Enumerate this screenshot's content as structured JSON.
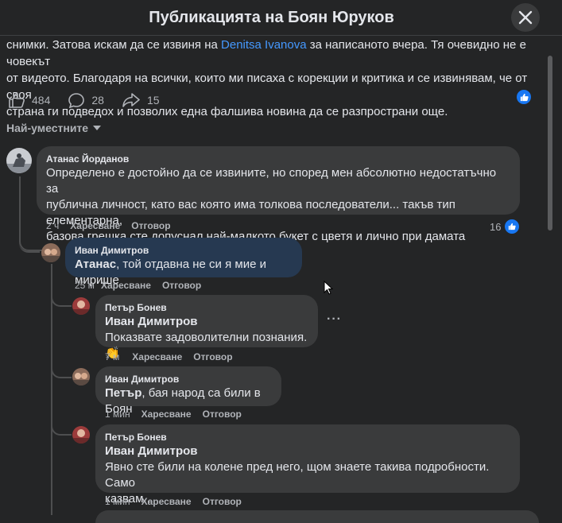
{
  "header": {
    "title": "Публикацията на Боян Юруков",
    "close_icon": "close-icon"
  },
  "post": {
    "line1_before": "снимки. Затова искам да се извиня на ",
    "line1_mention": "Denitsa Ivanova",
    "line1_after": " за написаното вчера. Тя очевидно не е човекът",
    "line2": "от видеото. Благодаря на всички, които ми писаха с корекции и критика и се извинявам, че от своя",
    "line3": "страна ги подведох и позволих една фалшива новина да се разпространи още."
  },
  "reactions": {
    "likes": "484",
    "comments": "28",
    "shares": "15"
  },
  "sort_label": "Най-уместните",
  "comments": [
    {
      "author": "Атанас Йорданов",
      "text_line1": "Определено е достойно да се извините, но според мен абсолютно недостатъчно за",
      "text_line2": "публична личност, като вас която има толкова последователи... такъв тип елементарна,",
      "text_line3": "базова грешка сте допуснал най-малкото букет с цветя и лично при дамата",
      "time": "2 ч",
      "like_label": "Харесване",
      "reply_label": "Отговор",
      "like_count": "16"
    },
    {
      "author": "Иван Димитров",
      "tag": "Атанас",
      "text": ", той отдавна не си я мие и мирише",
      "time": "25 м",
      "like_label": "Харесване",
      "reply_label": "Отговор"
    },
    {
      "author": "Петър Бонев",
      "tag": "Иван Димитров",
      "text": "Показвате задоволителни познания. 👏",
      "time": "7 м",
      "like_label": "Харесване",
      "reply_label": "Отговор"
    },
    {
      "author": "Иван Димитров",
      "tag": "Петър",
      "text": ", бая народ са били в Боян",
      "time": "1 мин",
      "like_label": "Харесване",
      "reply_label": "Отговор"
    },
    {
      "author": "Петър Бонев",
      "tag": "Иван Димитров",
      "text_line1": "Явно сте били на колене пред него, щом знаете такива подробности. Само",
      "text_line2": "казвам...",
      "time": "1 мин",
      "like_label": "Харесване",
      "reply_label": "Отговор"
    }
  ],
  "colors": {
    "background": "#242526",
    "bubble": "#3a3b3c",
    "highlight_bubble": "#263951",
    "accent": "#1877f2",
    "mention": "#4599ff"
  }
}
